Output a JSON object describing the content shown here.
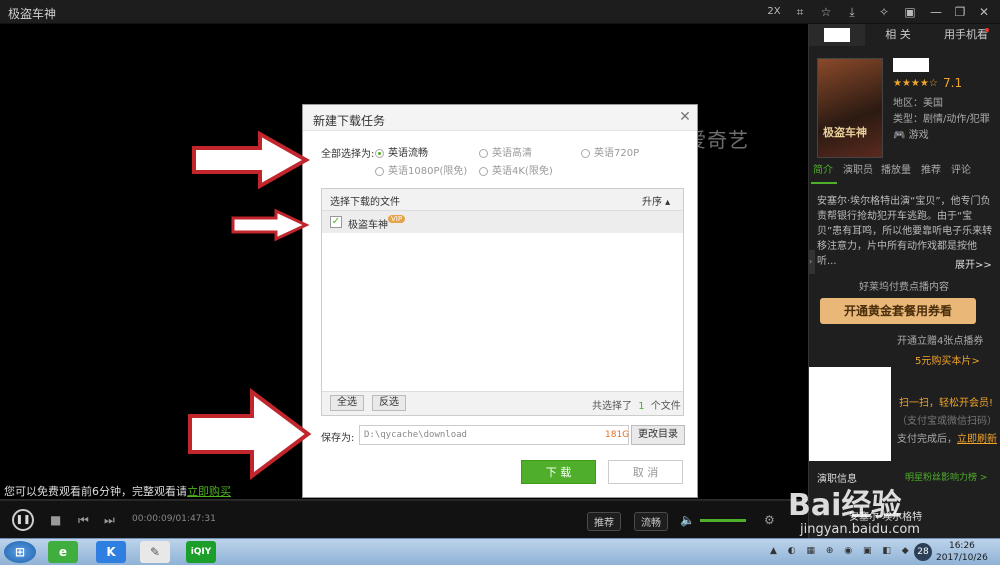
{
  "window": {
    "title": "极盗车神"
  },
  "titlebar_buttons": [
    "2X"
  ],
  "video": {
    "watermark": "爱奇艺",
    "free_tip": "您可以免费观看前6分钟，完整观看请",
    "free_tip_link": "立即购买"
  },
  "controls": {
    "time": "00:00:09/01:47:31",
    "recommend": "推荐",
    "quality": "流畅"
  },
  "panel": {
    "tabs": [
      "",
      "相 关",
      "用手机看"
    ],
    "rating": "7.1",
    "region": "地区：美国",
    "genre": "类型：剧情/动作/犯罪",
    "game": "游戏",
    "poster_text": "极盗车神",
    "subtabs": [
      "简介",
      "演职员",
      "播放量",
      "推荐",
      "评论"
    ],
    "intro": "安塞尔·埃尔格特出演“宝贝”，他专门负责帮银行抢劫犯开车逃跑。由于“宝贝”患有耳鸣，所以他要靠听电子乐来转移注意力，片中所有动作戏都是按他听...",
    "expand": "展开>>",
    "hollywood_tip": "好莱坞付费点播内容",
    "vip_button": "开通黄金套餐用券看",
    "vip_gift": "开通立赠4张点播券",
    "buy_single": "5元购买本片>",
    "scan_title": "扫一扫，轻松开会员!",
    "scan_support": "（支付宝或微信扫码）",
    "scan_refresh_prefix": "支付完成后，",
    "scan_refresh_link": "立即刷新",
    "cast_label": "演职信息",
    "fans_rank": "明星粉丝影响力榜 >",
    "actor": "安塞尔·埃尔格特"
  },
  "dialog": {
    "title": "新建下载任务",
    "select_all_label": "全部选择为:",
    "quality_options": [
      {
        "label": "英语流畅",
        "selected": true
      },
      {
        "label": "英语高清",
        "selected": false
      },
      {
        "label": "英语720P",
        "selected": false
      },
      {
        "label": "英语1080P(限免)",
        "selected": false
      },
      {
        "label": "英语4K(限免)",
        "selected": false
      }
    ],
    "file_header": "选择下载的文件",
    "sort_label": "升序",
    "file_name": "极盗车神",
    "file_badge": "VIP",
    "select_all_btn": "全选",
    "invert_btn": "反选",
    "selected_prefix": "共选择了",
    "selected_count": "1",
    "selected_suffix": "个文件",
    "save_label": "保存为:",
    "save_path": "D:\\qycache\\download",
    "free_space": "181G",
    "change_dir_btn": "更改目录",
    "download_btn": "下 载",
    "cancel_btn": "取 消"
  },
  "taskbar": {
    "clock_time": "16:26",
    "clock_date": "2017/10/26",
    "tray_badge": "28"
  },
  "watermark_baidu": "Bai经验",
  "watermark_url": "jingyan.baidu.com",
  "colors": {
    "accent_green": "#4fae2a",
    "vip_gold": "#e9b878",
    "arrow_red": "#c0262c"
  }
}
